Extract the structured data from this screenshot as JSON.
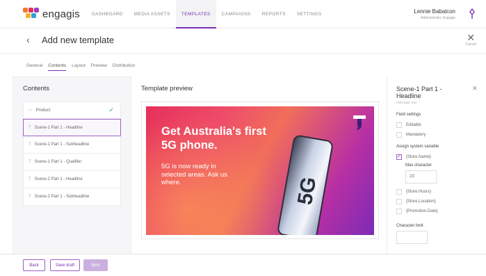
{
  "app": {
    "name": "engagis"
  },
  "nav": {
    "items": [
      "DASHBOARD",
      "MEDIA ASSETS",
      "TEMPLATES",
      "CAMPAIGNS",
      "REPORTS",
      "SETTINGS"
    ],
    "active": "TEMPLATES"
  },
  "user": {
    "name": "Lennie Babalcon",
    "role": "Administrator, Engagis"
  },
  "header": {
    "title": "Add new template",
    "cancel_label": "Cancel"
  },
  "tabs": [
    "General",
    "Contents",
    "Layout",
    "Preview",
    "Distribution"
  ],
  "active_tab": "Contents",
  "contents": {
    "title": "Contents",
    "items": [
      {
        "label": "Product",
        "icon": "image-icon",
        "status": "checked"
      },
      {
        "label": "Scene-1 Part 1 - Headline",
        "icon": "text-icon",
        "selected": true
      },
      {
        "label": "Scene-1 Part 1 - Subheadline",
        "icon": "text-icon"
      },
      {
        "label": "Scene-1 Part 1 - Qualifier",
        "icon": "text-icon"
      },
      {
        "label": "Scene-2 Part 1 - Headline",
        "icon": "text-icon"
      },
      {
        "label": "Scene-2 Part 1 - Subheadline",
        "icon": "text-icon"
      }
    ]
  },
  "preview": {
    "title": "Template preview",
    "headline": "Get Australia's first 5G phone.",
    "subline": "5G is now ready in selected areas. Ask us where.",
    "phone_text": "5G"
  },
  "right_panel": {
    "title": "Scene-1 Part 1 - Headline",
    "field_type": "Field type: text",
    "field_settings_label": "Field settings",
    "editable_label": "Editable",
    "mandatory_label": "Mandatory",
    "assign_label": "Assign system variable",
    "variables": [
      {
        "label": "{Store.Name}",
        "checked": true
      },
      {
        "label": "{Store.Hours}",
        "checked": false
      },
      {
        "label": "{Store.Location}",
        "checked": false
      },
      {
        "label": "{Promotion.Date}",
        "checked": false
      }
    ],
    "max_character_label": "Max character",
    "max_character_value": "23",
    "character_limit_label": "Character limit"
  },
  "footer": {
    "back": "Back",
    "save_draft": "Save draft",
    "next": "Next"
  },
  "colors": {
    "accent": "#7a2fb0",
    "success": "#3cae4a"
  }
}
